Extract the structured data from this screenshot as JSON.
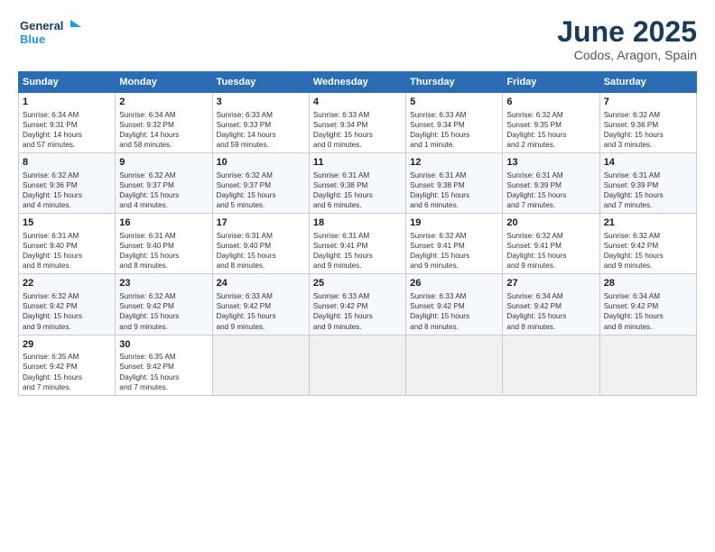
{
  "logo": {
    "line1": "General",
    "line2": "Blue"
  },
  "title": "June 2025",
  "location": "Codos, Aragon, Spain",
  "days_of_week": [
    "Sunday",
    "Monday",
    "Tuesday",
    "Wednesday",
    "Thursday",
    "Friday",
    "Saturday"
  ],
  "weeks": [
    [
      {
        "day": "1",
        "lines": [
          "Sunrise: 6:34 AM",
          "Sunset: 9:31 PM",
          "Daylight: 14 hours",
          "and 57 minutes."
        ]
      },
      {
        "day": "2",
        "lines": [
          "Sunrise: 6:34 AM",
          "Sunset: 9:32 PM",
          "Daylight: 14 hours",
          "and 58 minutes."
        ]
      },
      {
        "day": "3",
        "lines": [
          "Sunrise: 6:33 AM",
          "Sunset: 9:33 PM",
          "Daylight: 14 hours",
          "and 59 minutes."
        ]
      },
      {
        "day": "4",
        "lines": [
          "Sunrise: 6:33 AM",
          "Sunset: 9:34 PM",
          "Daylight: 15 hours",
          "and 0 minutes."
        ]
      },
      {
        "day": "5",
        "lines": [
          "Sunrise: 6:33 AM",
          "Sunset: 9:34 PM",
          "Daylight: 15 hours",
          "and 1 minute."
        ]
      },
      {
        "day": "6",
        "lines": [
          "Sunrise: 6:32 AM",
          "Sunset: 9:35 PM",
          "Daylight: 15 hours",
          "and 2 minutes."
        ]
      },
      {
        "day": "7",
        "lines": [
          "Sunrise: 6:32 AM",
          "Sunset: 9:36 PM",
          "Daylight: 15 hours",
          "and 3 minutes."
        ]
      }
    ],
    [
      {
        "day": "8",
        "lines": [
          "Sunrise: 6:32 AM",
          "Sunset: 9:36 PM",
          "Daylight: 15 hours",
          "and 4 minutes."
        ]
      },
      {
        "day": "9",
        "lines": [
          "Sunrise: 6:32 AM",
          "Sunset: 9:37 PM",
          "Daylight: 15 hours",
          "and 4 minutes."
        ]
      },
      {
        "day": "10",
        "lines": [
          "Sunrise: 6:32 AM",
          "Sunset: 9:37 PM",
          "Daylight: 15 hours",
          "and 5 minutes."
        ]
      },
      {
        "day": "11",
        "lines": [
          "Sunrise: 6:31 AM",
          "Sunset: 9:38 PM",
          "Daylight: 15 hours",
          "and 6 minutes."
        ]
      },
      {
        "day": "12",
        "lines": [
          "Sunrise: 6:31 AM",
          "Sunset: 9:38 PM",
          "Daylight: 15 hours",
          "and 6 minutes."
        ]
      },
      {
        "day": "13",
        "lines": [
          "Sunrise: 6:31 AM",
          "Sunset: 9:39 PM",
          "Daylight: 15 hours",
          "and 7 minutes."
        ]
      },
      {
        "day": "14",
        "lines": [
          "Sunrise: 6:31 AM",
          "Sunset: 9:39 PM",
          "Daylight: 15 hours",
          "and 7 minutes."
        ]
      }
    ],
    [
      {
        "day": "15",
        "lines": [
          "Sunrise: 6:31 AM",
          "Sunset: 9:40 PM",
          "Daylight: 15 hours",
          "and 8 minutes."
        ]
      },
      {
        "day": "16",
        "lines": [
          "Sunrise: 6:31 AM",
          "Sunset: 9:40 PM",
          "Daylight: 15 hours",
          "and 8 minutes."
        ]
      },
      {
        "day": "17",
        "lines": [
          "Sunrise: 6:31 AM",
          "Sunset: 9:40 PM",
          "Daylight: 15 hours",
          "and 8 minutes."
        ]
      },
      {
        "day": "18",
        "lines": [
          "Sunrise: 6:31 AM",
          "Sunset: 9:41 PM",
          "Daylight: 15 hours",
          "and 9 minutes."
        ]
      },
      {
        "day": "19",
        "lines": [
          "Sunrise: 6:32 AM",
          "Sunset: 9:41 PM",
          "Daylight: 15 hours",
          "and 9 minutes."
        ]
      },
      {
        "day": "20",
        "lines": [
          "Sunrise: 6:32 AM",
          "Sunset: 9:41 PM",
          "Daylight: 15 hours",
          "and 9 minutes."
        ]
      },
      {
        "day": "21",
        "lines": [
          "Sunrise: 6:32 AM",
          "Sunset: 9:42 PM",
          "Daylight: 15 hours",
          "and 9 minutes."
        ]
      }
    ],
    [
      {
        "day": "22",
        "lines": [
          "Sunrise: 6:32 AM",
          "Sunset: 9:42 PM",
          "Daylight: 15 hours",
          "and 9 minutes."
        ]
      },
      {
        "day": "23",
        "lines": [
          "Sunrise: 6:32 AM",
          "Sunset: 9:42 PM",
          "Daylight: 15 hours",
          "and 9 minutes."
        ]
      },
      {
        "day": "24",
        "lines": [
          "Sunrise: 6:33 AM",
          "Sunset: 9:42 PM",
          "Daylight: 15 hours",
          "and 9 minutes."
        ]
      },
      {
        "day": "25",
        "lines": [
          "Sunrise: 6:33 AM",
          "Sunset: 9:42 PM",
          "Daylight: 15 hours",
          "and 9 minutes."
        ]
      },
      {
        "day": "26",
        "lines": [
          "Sunrise: 6:33 AM",
          "Sunset: 9:42 PM",
          "Daylight: 15 hours",
          "and 8 minutes."
        ]
      },
      {
        "day": "27",
        "lines": [
          "Sunrise: 6:34 AM",
          "Sunset: 9:42 PM",
          "Daylight: 15 hours",
          "and 8 minutes."
        ]
      },
      {
        "day": "28",
        "lines": [
          "Sunrise: 6:34 AM",
          "Sunset: 9:42 PM",
          "Daylight: 15 hours",
          "and 8 minutes."
        ]
      }
    ],
    [
      {
        "day": "29",
        "lines": [
          "Sunrise: 6:35 AM",
          "Sunset: 9:42 PM",
          "Daylight: 15 hours",
          "and 7 minutes."
        ]
      },
      {
        "day": "30",
        "lines": [
          "Sunrise: 6:35 AM",
          "Sunset: 9:42 PM",
          "Daylight: 15 hours",
          "and 7 minutes."
        ]
      },
      null,
      null,
      null,
      null,
      null
    ]
  ]
}
